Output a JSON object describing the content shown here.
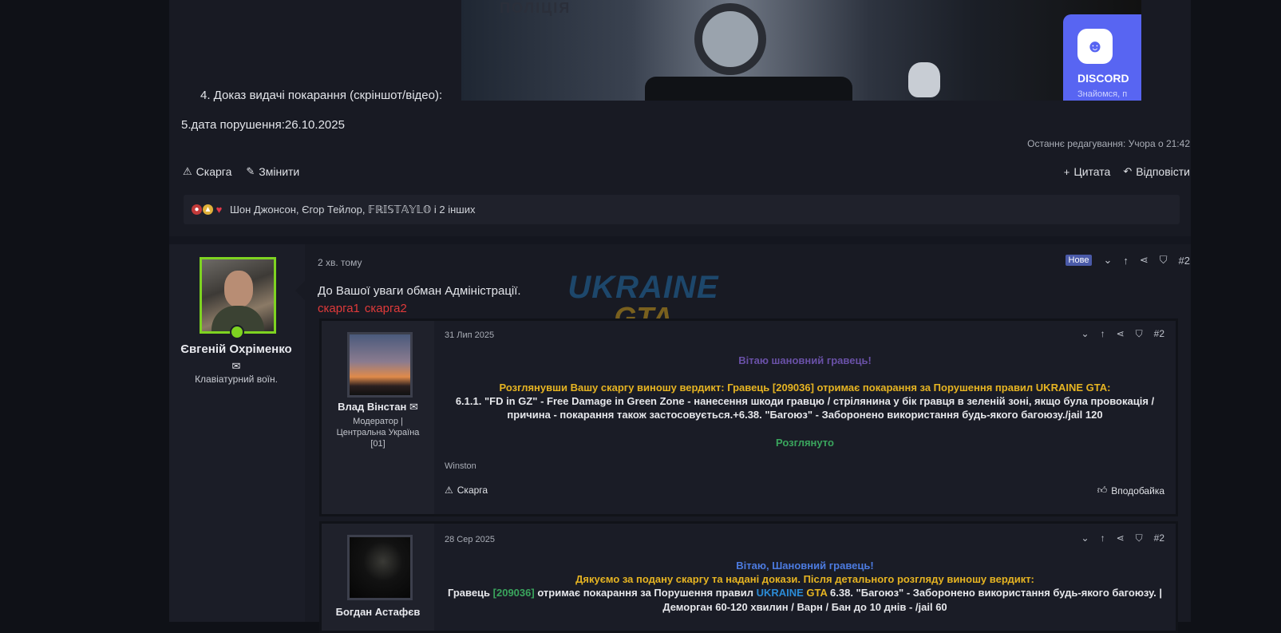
{
  "post1": {
    "image_text_police": "ПОЛІЦІЯ",
    "discord_title": "DISCORD",
    "discord_sub": "Знайомся, п",
    "line4": "4. Доказ видачі покарання (скріншот/відео):",
    "line5": "5.дата порушення:26.10.2025",
    "last_edit": "Останнє редагування: Учора о 21:42",
    "actions_left": [
      {
        "icon": "⚠",
        "label": "Скарга"
      },
      {
        "icon": "✎",
        "label": "Змінити"
      }
    ],
    "actions_right": [
      {
        "icon": "+",
        "label": "Цитата"
      },
      {
        "icon": "↶",
        "label": "Відповісти"
      }
    ],
    "reactions_names": "Шон Джонсон, Єгор Тейлор, 𝔽ℝ𝕀𝕊𝕋𝔸𝕐𝕃𝕆 і 2 інших"
  },
  "post2": {
    "author_name": "Євгеній Охріменко",
    "author_title": "Клавіатурний воїн.",
    "time": "2 хв. тому",
    "badge_new": "Нове",
    "post_number": "#2",
    "text": "До Вашої уваги обман Адміністрації.",
    "link1": "скарга1",
    "link2": "скарга2",
    "watermark_top": "UKRAINE",
    "watermark_bottom": "GTA"
  },
  "quote1": {
    "author": "Влад Вінстан",
    "role": "Модератор | Центральна Україна [01]",
    "date": "31 Лип 2025",
    "number": "#2",
    "greeting": "Вітаю шановний гравець!",
    "verdict": "Розглянувши Вашу скаргу виношу вердикт: Гравець [209036] отримає покарання за Порушення правил UKRAINE GTA:",
    "rule_line1": "6.1.1. \"FD in GZ\" - Free Damage in Green Zone - нанесення шкоди гравцю / стрілянина у бік гравця в зеленій зоні, якщо була провокація /",
    "rule_line2": "причина - покарання також застосовується.+6.38. \"Багоюз\" - Заборонено використання будь-якого багоюзу./jail 120",
    "status": "Розглянуто",
    "signature": "Winston",
    "report": "Скарга",
    "like": "Вподобайка"
  },
  "quote2": {
    "author": "Богдан Астафєв",
    "date": "28 Сер 2025",
    "number": "#2",
    "greeting": "Вітаю, Шановний гравець!",
    "thanks": "Дякуємо за подану скаргу та надані докази. Після детального розгляду виношу вердикт:",
    "l3_a": "Гравець ",
    "l3_id": "[209036]",
    "l3_b": " отримає покарання за Порушення правил ",
    "l3_ukraine": "UKRAINE",
    "l3_gta": "GTA",
    "l3_c": " 6.38. \"Багоюз\" - Заборонено використання будь-якого багоюзу. |",
    "l4": "Деморган 60-120 хвилин / Варн / Бан до 10 днів - /jail 60"
  }
}
